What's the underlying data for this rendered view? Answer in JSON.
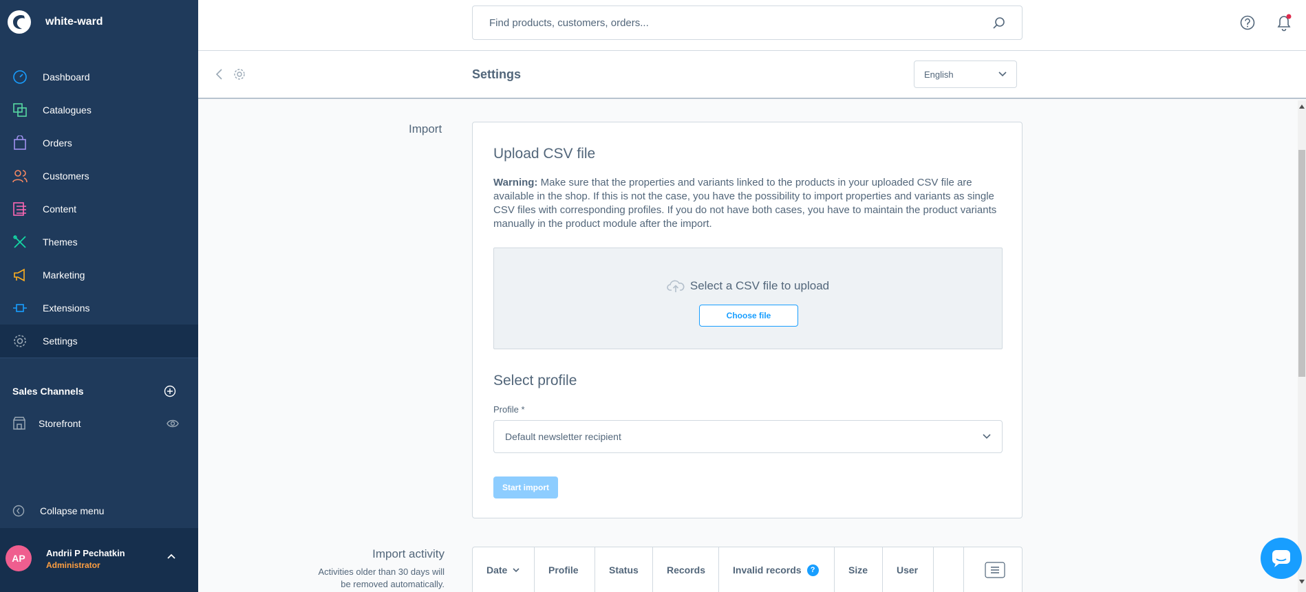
{
  "brand": {
    "name": "white-ward"
  },
  "nav": [
    {
      "label": "Dashboard",
      "icon": "dashboard-icon",
      "color": "#189eff"
    },
    {
      "label": "Catalogues",
      "icon": "catalogues-icon",
      "color": "#57d9a3"
    },
    {
      "label": "Orders",
      "icon": "orders-icon",
      "color": "#a092f0"
    },
    {
      "label": "Customers",
      "icon": "customers-icon",
      "color": "#f88962"
    },
    {
      "label": "Content",
      "icon": "content-icon",
      "color": "#ff68b4"
    },
    {
      "label": "Themes",
      "icon": "themes-icon",
      "color": "#14d7a5"
    },
    {
      "label": "Marketing",
      "icon": "marketing-icon",
      "color": "#ffd700"
    },
    {
      "label": "Extensions",
      "icon": "extensions-icon",
      "color": "#189eff"
    },
    {
      "label": "Settings",
      "icon": "settings-icon",
      "color": "#9aa8b5"
    }
  ],
  "sales_channels": {
    "title": "Sales Channels",
    "items": [
      {
        "label": "Storefront"
      }
    ]
  },
  "collapse_label": "Collapse menu",
  "user": {
    "initials": "AP",
    "name": "Andrii P Pechatkin",
    "role": "Administrator"
  },
  "search": {
    "placeholder": "Find products, customers, orders..."
  },
  "smartbar": {
    "title": "Settings",
    "language": "English"
  },
  "import": {
    "section_label": "Import",
    "card_title": "Upload CSV file",
    "warning_bold": "Warning:",
    "warning_text": " Make sure that the properties and variants linked to the products in your uploaded CSV file are available in the shop. If this is not the case, you have the possibility to import properties and variants as single CSV files with corresponding profiles. If you do not have both cases, you have to maintain the product variants manually in the product module after the import.",
    "dropzone_text": "Select a CSV file to upload",
    "choose_button": "Choose file",
    "profile_title": "Select profile",
    "profile_label": "Profile *",
    "profile_value": "Default newsletter recipient",
    "start_button": "Start import"
  },
  "activity": {
    "title": "Import activity",
    "note": "Activities older than 30 days will be removed automatically.",
    "columns": [
      "Date",
      "Profile",
      "Status",
      "Records",
      "Invalid records",
      "Size",
      "User"
    ]
  },
  "colors": {
    "sidebar": "#1f3a5b",
    "accent": "#189eff",
    "role": "#ff9f40",
    "avatar": "#ef5e8f"
  }
}
